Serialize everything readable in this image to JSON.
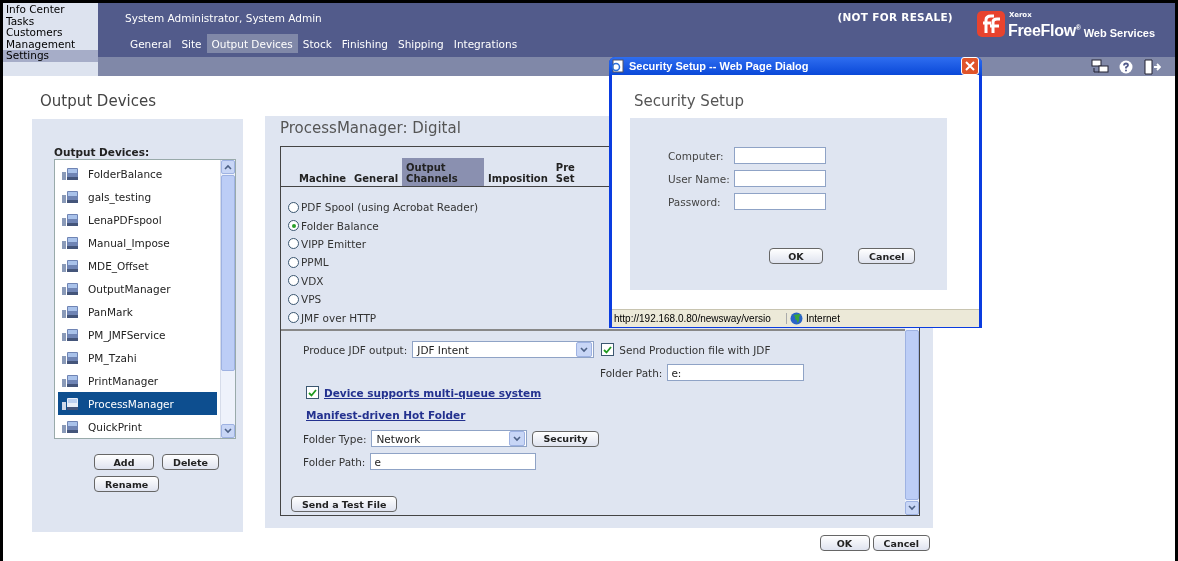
{
  "nav": {
    "items": [
      {
        "label": "Info Center",
        "selected": false
      },
      {
        "label": "Tasks",
        "selected": false
      },
      {
        "label": "Customers",
        "selected": false
      },
      {
        "label": "Management",
        "selected": false
      },
      {
        "label": "Settings",
        "selected": true
      }
    ]
  },
  "header": {
    "user": "System Administrator, System Admin",
    "notice": "(NOT FOR RESALE)",
    "logo": {
      "brand": "Xerox",
      "product": "FreeFlow",
      "mark": "®",
      "suffix": "Web Services"
    },
    "tabs": [
      {
        "label": "General",
        "selected": false
      },
      {
        "label": "Site",
        "selected": false
      },
      {
        "label": "Output Devices",
        "selected": true
      },
      {
        "label": "Stock",
        "selected": false
      },
      {
        "label": "Finishing",
        "selected": false
      },
      {
        "label": "Shipping",
        "selected": false
      },
      {
        "label": "Integrations",
        "selected": false
      }
    ]
  },
  "page_title": "Output Devices",
  "devices": {
    "label": "Output Devices:",
    "items": [
      {
        "name": "FolderBalance",
        "selected": false
      },
      {
        "name": "gals_testing",
        "selected": false
      },
      {
        "name": "LenaPDFspool",
        "selected": false
      },
      {
        "name": "Manual_Impose",
        "selected": false
      },
      {
        "name": "MDE_Offset",
        "selected": false
      },
      {
        "name": "OutputManager",
        "selected": false
      },
      {
        "name": "PanMark",
        "selected": false
      },
      {
        "name": "PM_JMFService",
        "selected": false
      },
      {
        "name": "PM_Tzahi",
        "selected": false
      },
      {
        "name": "PrintManager",
        "selected": false
      },
      {
        "name": "ProcessManager",
        "selected": true
      },
      {
        "name": "QuickPrint",
        "selected": false
      }
    ],
    "buttons": [
      "Add",
      "Delete",
      "Rename"
    ]
  },
  "detail": {
    "title": "ProcessManager: Digital",
    "tabs": [
      {
        "label": "Machine",
        "selected": false
      },
      {
        "label": "General",
        "selected": false
      },
      {
        "label": "Output Channels",
        "selected": true
      },
      {
        "label": "Imposition",
        "selected": false
      },
      {
        "label": "Pre Set",
        "selected": false
      }
    ],
    "channels": [
      {
        "label": "PDF Spool (using Acrobat Reader)",
        "selected": false
      },
      {
        "label": "Folder Balance",
        "selected": true
      },
      {
        "label": "VIPP Emitter",
        "selected": false
      },
      {
        "label": "PPML",
        "selected": false
      },
      {
        "label": "VDX",
        "selected": false
      },
      {
        "label": "VPS",
        "selected": false
      },
      {
        "label": "JMF over HTTP",
        "selected": false
      }
    ],
    "jdf": {
      "label": "Produce JDF output:",
      "value": "JDF Intent",
      "send_with_jdf": {
        "label": "Send Production file with JDF",
        "checked": true
      },
      "folder_path": {
        "label": "Folder Path:",
        "value": "e:"
      }
    },
    "multi_queue": {
      "label": "Device supports multi-queue system",
      "checked": true
    },
    "hot_folder": "Manifest-driven Hot Folder",
    "folder_type": {
      "label": "Folder Type:",
      "value": "Network"
    },
    "security_button": "Security",
    "folder_path": {
      "label": "Folder Path:",
      "value": "e"
    },
    "test_button": "Send a Test File"
  },
  "footer_buttons": [
    "OK",
    "Cancel"
  ],
  "dialog": {
    "title": "Security Setup -- Web Page Dialog",
    "heading": "Security Setup",
    "fields": [
      {
        "label": "Computer:"
      },
      {
        "label": "User Name:"
      },
      {
        "label": "Password:"
      }
    ],
    "buttons": [
      "OK",
      "Cancel"
    ],
    "status_url": "http://192.168.0.80/newsway/versio",
    "zone": "Internet"
  }
}
